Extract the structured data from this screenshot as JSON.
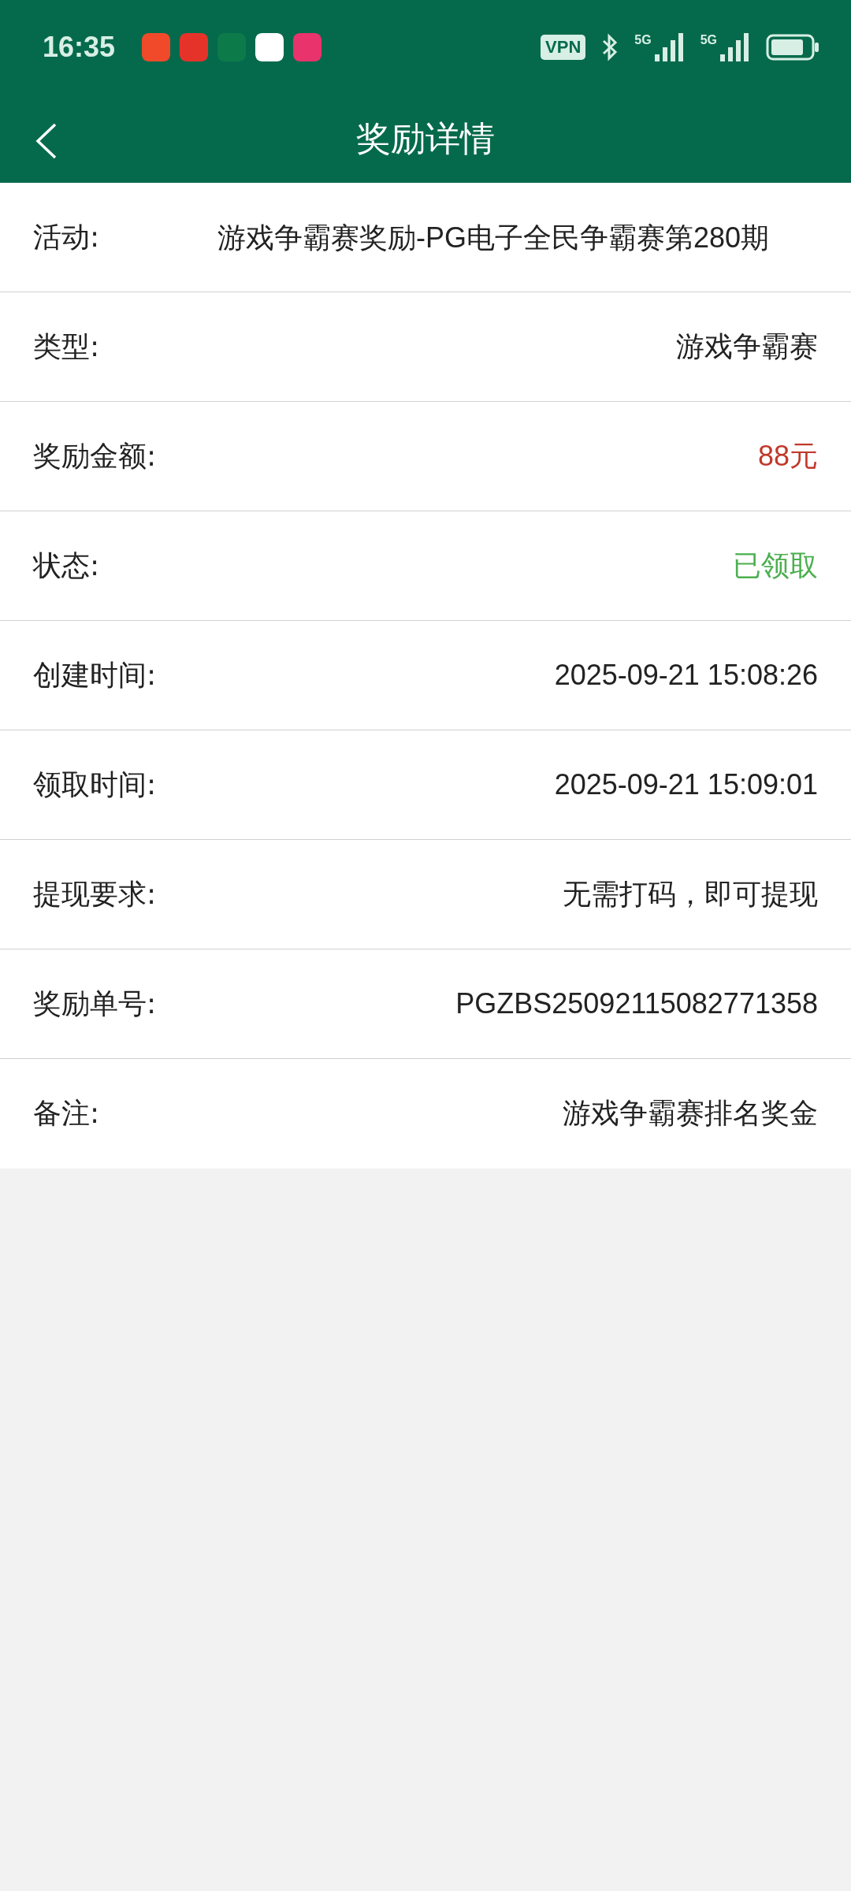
{
  "status_bar": {
    "time": "16:35",
    "vpn": "VPN",
    "networks": [
      "5G",
      "5G"
    ]
  },
  "header": {
    "title": "奖励详情"
  },
  "rows": [
    {
      "label": "活动:",
      "value": "游戏争霸赛奖励-PG电子全民争霸赛第280期",
      "kind": "long"
    },
    {
      "label": "类型:",
      "value": "游戏争霸赛",
      "kind": "text"
    },
    {
      "label": "奖励金额:",
      "value": "88元",
      "kind": "amount"
    },
    {
      "label": "状态:",
      "value": "已领取",
      "kind": "status"
    },
    {
      "label": "创建时间:",
      "value": "2025-09-21 15:08:26",
      "kind": "text"
    },
    {
      "label": "领取时间:",
      "value": "2025-09-21 15:09:01",
      "kind": "text"
    },
    {
      "label": "提现要求:",
      "value": "无需打码，即可提现",
      "kind": "text"
    },
    {
      "label": "奖励单号:",
      "value": "PGZBS25092115082771358",
      "kind": "text"
    },
    {
      "label": "备注:",
      "value": "游戏争霸赛排名奖金",
      "kind": "text"
    }
  ]
}
